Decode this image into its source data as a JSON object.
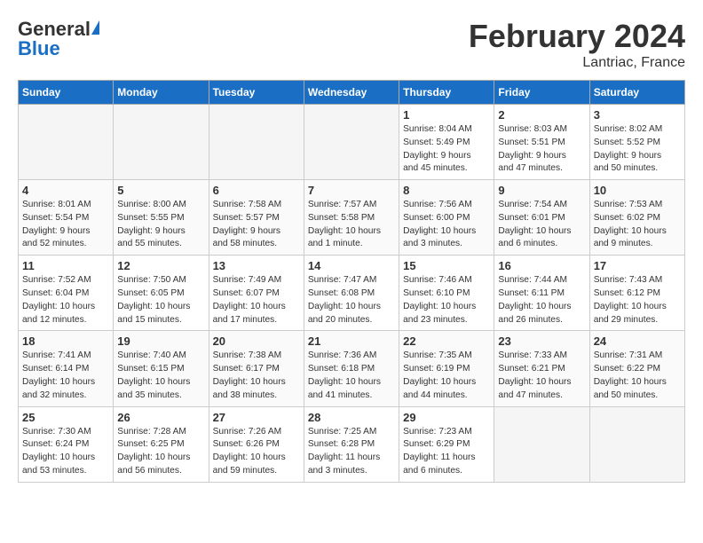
{
  "header": {
    "logo_general": "General",
    "logo_blue": "Blue",
    "month_title": "February 2024",
    "location": "Lantriac, France"
  },
  "weekdays": [
    "Sunday",
    "Monday",
    "Tuesday",
    "Wednesday",
    "Thursday",
    "Friday",
    "Saturday"
  ],
  "weeks": [
    [
      {
        "day": "",
        "info": ""
      },
      {
        "day": "",
        "info": ""
      },
      {
        "day": "",
        "info": ""
      },
      {
        "day": "",
        "info": ""
      },
      {
        "day": "1",
        "info": "Sunrise: 8:04 AM\nSunset: 5:49 PM\nDaylight: 9 hours\nand 45 minutes."
      },
      {
        "day": "2",
        "info": "Sunrise: 8:03 AM\nSunset: 5:51 PM\nDaylight: 9 hours\nand 47 minutes."
      },
      {
        "day": "3",
        "info": "Sunrise: 8:02 AM\nSunset: 5:52 PM\nDaylight: 9 hours\nand 50 minutes."
      }
    ],
    [
      {
        "day": "4",
        "info": "Sunrise: 8:01 AM\nSunset: 5:54 PM\nDaylight: 9 hours\nand 52 minutes."
      },
      {
        "day": "5",
        "info": "Sunrise: 8:00 AM\nSunset: 5:55 PM\nDaylight: 9 hours\nand 55 minutes."
      },
      {
        "day": "6",
        "info": "Sunrise: 7:58 AM\nSunset: 5:57 PM\nDaylight: 9 hours\nand 58 minutes."
      },
      {
        "day": "7",
        "info": "Sunrise: 7:57 AM\nSunset: 5:58 PM\nDaylight: 10 hours\nand 1 minute."
      },
      {
        "day": "8",
        "info": "Sunrise: 7:56 AM\nSunset: 6:00 PM\nDaylight: 10 hours\nand 3 minutes."
      },
      {
        "day": "9",
        "info": "Sunrise: 7:54 AM\nSunset: 6:01 PM\nDaylight: 10 hours\nand 6 minutes."
      },
      {
        "day": "10",
        "info": "Sunrise: 7:53 AM\nSunset: 6:02 PM\nDaylight: 10 hours\nand 9 minutes."
      }
    ],
    [
      {
        "day": "11",
        "info": "Sunrise: 7:52 AM\nSunset: 6:04 PM\nDaylight: 10 hours\nand 12 minutes."
      },
      {
        "day": "12",
        "info": "Sunrise: 7:50 AM\nSunset: 6:05 PM\nDaylight: 10 hours\nand 15 minutes."
      },
      {
        "day": "13",
        "info": "Sunrise: 7:49 AM\nSunset: 6:07 PM\nDaylight: 10 hours\nand 17 minutes."
      },
      {
        "day": "14",
        "info": "Sunrise: 7:47 AM\nSunset: 6:08 PM\nDaylight: 10 hours\nand 20 minutes."
      },
      {
        "day": "15",
        "info": "Sunrise: 7:46 AM\nSunset: 6:10 PM\nDaylight: 10 hours\nand 23 minutes."
      },
      {
        "day": "16",
        "info": "Sunrise: 7:44 AM\nSunset: 6:11 PM\nDaylight: 10 hours\nand 26 minutes."
      },
      {
        "day": "17",
        "info": "Sunrise: 7:43 AM\nSunset: 6:12 PM\nDaylight: 10 hours\nand 29 minutes."
      }
    ],
    [
      {
        "day": "18",
        "info": "Sunrise: 7:41 AM\nSunset: 6:14 PM\nDaylight: 10 hours\nand 32 minutes."
      },
      {
        "day": "19",
        "info": "Sunrise: 7:40 AM\nSunset: 6:15 PM\nDaylight: 10 hours\nand 35 minutes."
      },
      {
        "day": "20",
        "info": "Sunrise: 7:38 AM\nSunset: 6:17 PM\nDaylight: 10 hours\nand 38 minutes."
      },
      {
        "day": "21",
        "info": "Sunrise: 7:36 AM\nSunset: 6:18 PM\nDaylight: 10 hours\nand 41 minutes."
      },
      {
        "day": "22",
        "info": "Sunrise: 7:35 AM\nSunset: 6:19 PM\nDaylight: 10 hours\nand 44 minutes."
      },
      {
        "day": "23",
        "info": "Sunrise: 7:33 AM\nSunset: 6:21 PM\nDaylight: 10 hours\nand 47 minutes."
      },
      {
        "day": "24",
        "info": "Sunrise: 7:31 AM\nSunset: 6:22 PM\nDaylight: 10 hours\nand 50 minutes."
      }
    ],
    [
      {
        "day": "25",
        "info": "Sunrise: 7:30 AM\nSunset: 6:24 PM\nDaylight: 10 hours\nand 53 minutes."
      },
      {
        "day": "26",
        "info": "Sunrise: 7:28 AM\nSunset: 6:25 PM\nDaylight: 10 hours\nand 56 minutes."
      },
      {
        "day": "27",
        "info": "Sunrise: 7:26 AM\nSunset: 6:26 PM\nDaylight: 10 hours\nand 59 minutes."
      },
      {
        "day": "28",
        "info": "Sunrise: 7:25 AM\nSunset: 6:28 PM\nDaylight: 11 hours\nand 3 minutes."
      },
      {
        "day": "29",
        "info": "Sunrise: 7:23 AM\nSunset: 6:29 PM\nDaylight: 11 hours\nand 6 minutes."
      },
      {
        "day": "",
        "info": ""
      },
      {
        "day": "",
        "info": ""
      }
    ]
  ]
}
